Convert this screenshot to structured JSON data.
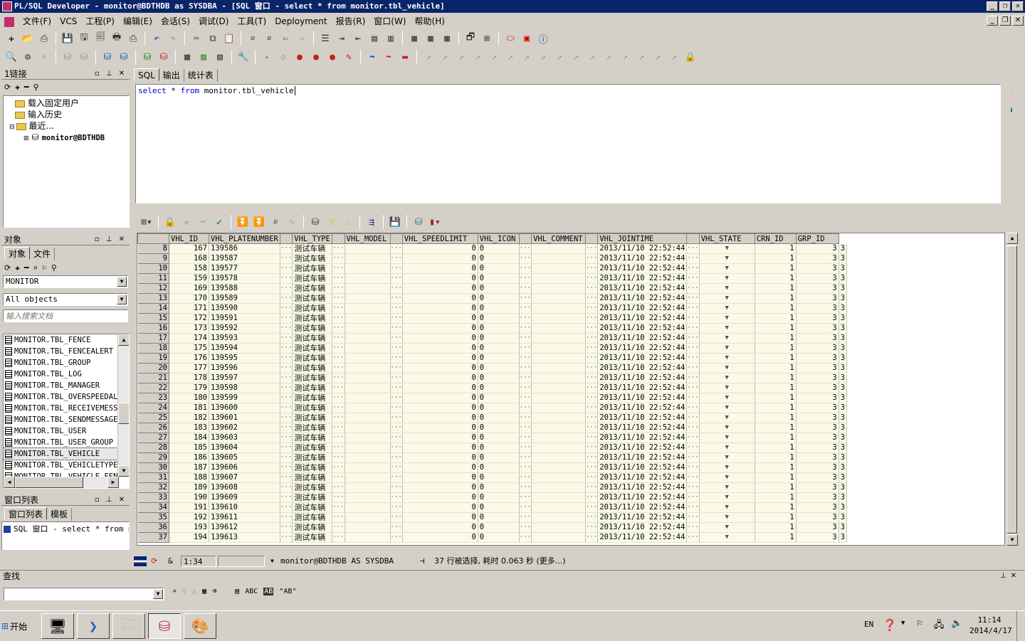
{
  "window": {
    "title": "PL/SQL Developer - monitor@BDTHDB as SYSDBA - [SQL 窗口 - select * from monitor.tbl_vehicle]"
  },
  "menu": [
    "文件(F)",
    "VCS",
    "工程(P)",
    "编辑(E)",
    "会话(S)",
    "调试(D)",
    "工具(T)",
    "Deployment",
    "报告(R)",
    "窗口(W)",
    "帮助(H)"
  ],
  "connection_panel": {
    "title": "1链接",
    "tree": [
      {
        "label": "载入固定用户",
        "indent": 1
      },
      {
        "label": "输入历史",
        "indent": 1
      },
      {
        "label": "最近...",
        "indent": 0
      },
      {
        "label": "monitor@BDTHDB",
        "indent": 2
      }
    ]
  },
  "object_panel": {
    "title": "对象",
    "tabs": [
      "对象",
      "文件"
    ],
    "owner_select": "MONITOR",
    "type_select": "All objects",
    "search_placeholder": "输入搜索文档",
    "objects": [
      "MONITOR.TBL_FENCE",
      "MONITOR.TBL_FENCEALERT",
      "MONITOR.TBL_GROUP",
      "MONITOR.TBL_LOG",
      "MONITOR.TBL_MANAGER",
      "MONITOR.TBL_OVERSPEEDALEI",
      "MONITOR.TBL_RECEIVEMESSAG",
      "MONITOR.TBL_SENDMESSAGE",
      "MONITOR.TBL_USER",
      "MONITOR.TBL_USER_GROUP",
      "MONITOR.TBL_VEHICLE",
      "MONITOR.TBL_VEHICLETYPE",
      "MONITOR.TBL_VEHICLE_FENCI"
    ],
    "selected_object": "MONITOR.TBL_VEHICLE"
  },
  "window_list_panel": {
    "title": "窗口列表",
    "tabs": [
      "窗口列表",
      "模板"
    ],
    "items": [
      "SQL 窗口 - select * from mo"
    ]
  },
  "editor": {
    "tabs": [
      "SQL",
      "输出",
      "统计表"
    ],
    "active_tab": "SQL",
    "sql_tokens": [
      {
        "text": "select",
        "kind": "kw"
      },
      {
        "text": " * ",
        "kind": "plain"
      },
      {
        "text": "from",
        "kind": "kw"
      },
      {
        "text": " monitor.tbl_vehicle",
        "kind": "plain"
      }
    ]
  },
  "grid": {
    "columns": [
      "VHL_ID",
      "VHL_PLATENUMBER",
      "VHL_TYPE",
      "VHL_MODEL",
      "VHL_SPEEDLIMIT",
      "VHL_ICON",
      "VHL_COMMENT",
      "VHL_JOINTIME",
      "VHL_STATE",
      "CRN_ID",
      "GRP_ID"
    ],
    "rows": [
      [
        8,
        167,
        "139586",
        "测试车辆",
        "",
        0,
        "0",
        "",
        "2013/11/10 22:52:44",
        1,
        3,
        3
      ],
      [
        9,
        168,
        "139587",
        "测试车辆",
        "",
        0,
        "0",
        "",
        "2013/11/10 22:52:44",
        1,
        3,
        3
      ],
      [
        10,
        158,
        "139577",
        "测试车辆",
        "",
        0,
        "0",
        "",
        "2013/11/10 22:52:44",
        1,
        3,
        3
      ],
      [
        11,
        159,
        "139578",
        "测试车辆",
        "",
        0,
        "0",
        "",
        "2013/11/10 22:52:44",
        1,
        3,
        3
      ],
      [
        12,
        169,
        "139588",
        "测试车辆",
        "",
        0,
        "0",
        "",
        "2013/11/10 22:52:44",
        1,
        3,
        3
      ],
      [
        13,
        170,
        "139589",
        "测试车辆",
        "",
        0,
        "0",
        "",
        "2013/11/10 22:52:44",
        1,
        3,
        3
      ],
      [
        14,
        171,
        "139590",
        "测试车辆",
        "",
        0,
        "0",
        "",
        "2013/11/10 22:52:44",
        1,
        3,
        3
      ],
      [
        15,
        172,
        "139591",
        "测试车辆",
        "",
        0,
        "0",
        "",
        "2013/11/10 22:52:44",
        1,
        3,
        3
      ],
      [
        16,
        173,
        "139592",
        "测试车辆",
        "",
        0,
        "0",
        "",
        "2013/11/10 22:52:44",
        1,
        3,
        3
      ],
      [
        17,
        174,
        "139593",
        "测试车辆",
        "",
        0,
        "0",
        "",
        "2013/11/10 22:52:44",
        1,
        3,
        3
      ],
      [
        18,
        175,
        "139594",
        "测试车辆",
        "",
        0,
        "0",
        "",
        "2013/11/10 22:52:44",
        1,
        3,
        3
      ],
      [
        19,
        176,
        "139595",
        "测试车辆",
        "",
        0,
        "0",
        "",
        "2013/11/10 22:52:44",
        1,
        3,
        3
      ],
      [
        20,
        177,
        "139596",
        "测试车辆",
        "",
        0,
        "0",
        "",
        "2013/11/10 22:52:44",
        1,
        3,
        3
      ],
      [
        21,
        178,
        "139597",
        "测试车辆",
        "",
        0,
        "0",
        "",
        "2013/11/10 22:52:44",
        1,
        3,
        3
      ],
      [
        22,
        179,
        "139598",
        "测试车辆",
        "",
        0,
        "0",
        "",
        "2013/11/10 22:52:44",
        1,
        3,
        3
      ],
      [
        23,
        180,
        "139599",
        "测试车辆",
        "",
        0,
        "0",
        "",
        "2013/11/10 22:52:44",
        1,
        3,
        3
      ],
      [
        24,
        181,
        "139600",
        "测试车辆",
        "",
        0,
        "0",
        "",
        "2013/11/10 22:52:44",
        1,
        3,
        3
      ],
      [
        25,
        182,
        "139601",
        "测试车辆",
        "",
        0,
        "0",
        "",
        "2013/11/10 22:52:44",
        1,
        3,
        3
      ],
      [
        26,
        183,
        "139602",
        "测试车辆",
        "",
        0,
        "0",
        "",
        "2013/11/10 22:52:44",
        1,
        3,
        3
      ],
      [
        27,
        184,
        "139603",
        "测试车辆",
        "",
        0,
        "0",
        "",
        "2013/11/10 22:52:44",
        1,
        3,
        3
      ],
      [
        28,
        185,
        "139604",
        "测试车辆",
        "",
        0,
        "0",
        "",
        "2013/11/10 22:52:44",
        1,
        3,
        3
      ],
      [
        29,
        186,
        "139605",
        "测试车辆",
        "",
        0,
        "0",
        "",
        "2013/11/10 22:52:44",
        1,
        3,
        3
      ],
      [
        30,
        187,
        "139606",
        "测试车辆",
        "",
        0,
        "0",
        "",
        "2013/11/10 22:52:44",
        1,
        3,
        3
      ],
      [
        31,
        188,
        "139607",
        "测试车辆",
        "",
        0,
        "0",
        "",
        "2013/11/10 22:52:44",
        1,
        3,
        3
      ],
      [
        32,
        189,
        "139608",
        "测试车辆",
        "",
        0,
        "0",
        "",
        "2013/11/10 22:52:44",
        1,
        3,
        3
      ],
      [
        33,
        190,
        "139609",
        "测试车辆",
        "",
        0,
        "0",
        "",
        "2013/11/10 22:52:44",
        1,
        3,
        3
      ],
      [
        34,
        191,
        "139610",
        "测试车辆",
        "",
        0,
        "0",
        "",
        "2013/11/10 22:52:44",
        1,
        3,
        3
      ],
      [
        35,
        192,
        "139611",
        "测试车辆",
        "",
        0,
        "0",
        "",
        "2013/11/10 22:52:44",
        1,
        3,
        3
      ],
      [
        36,
        193,
        "139612",
        "测试车辆",
        "",
        0,
        "0",
        "",
        "2013/11/10 22:52:44",
        1,
        3,
        3
      ],
      [
        37,
        194,
        "139613",
        "测试车辆",
        "",
        0,
        "0",
        "",
        "2013/11/10 22:52:44",
        1,
        3,
        3
      ]
    ]
  },
  "status": {
    "cursor": "1:34",
    "connection": "monitor@BDTHDB AS SYSDBA",
    "message": "37 行被选择, 耗时 0.063 秒 (更多...)"
  },
  "find_bar": {
    "title": "查找",
    "labels": [
      "ABC",
      "AB",
      "\"AB\""
    ]
  },
  "taskbar": {
    "start_label": "开始",
    "lang": "EN",
    "time": "11:14",
    "date": "2014/4/17"
  },
  "colors": {
    "titlebar": "#0a246a",
    "keyword": "#0000c0",
    "grid_cell": "#fafae6"
  }
}
